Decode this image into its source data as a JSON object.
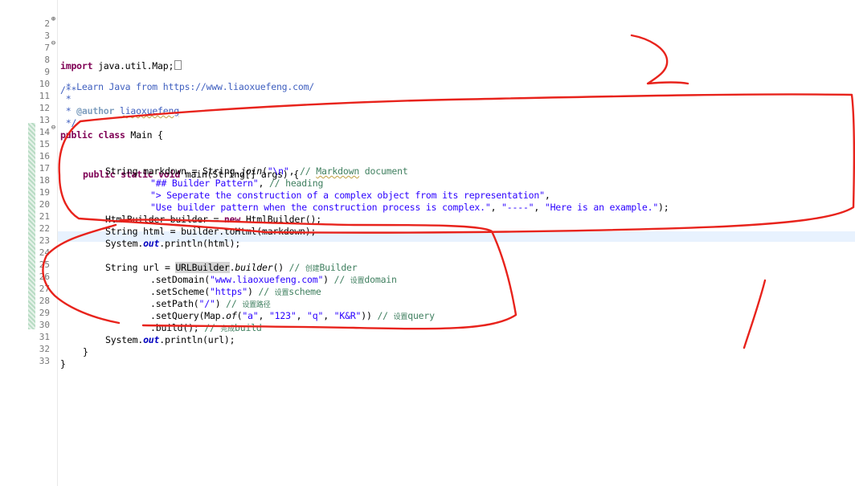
{
  "editor": {
    "lines": [
      {
        "n": "2",
        "fold": ""
      },
      {
        "n": "3",
        "fold": "⊕",
        "import_kw": "import",
        "import_rest": " java.util.Map;"
      },
      {
        "n": "7",
        "fold": ""
      },
      {
        "n": "8",
        "fold": "⊖",
        "text": "/**"
      },
      {
        "n": "9",
        "fold": "",
        "text_a": " * Learn Java from ",
        "text_b": "https://www.liaoxuefeng.com/"
      },
      {
        "n": "10",
        "fold": "",
        "text": " *"
      },
      {
        "n": "11",
        "fold": "",
        "tag": "@author",
        "author": "liaoxuefeng"
      },
      {
        "n": "12",
        "fold": "",
        "text": " */"
      },
      {
        "n": "13",
        "fold": "",
        "kw1": "public",
        "kw2": "class",
        "rest": " Main {"
      },
      {
        "n": "14",
        "fold": ""
      },
      {
        "n": "15",
        "fold": "⊖",
        "kw1": "public",
        "kw2": "static",
        "kw3": "void",
        "rest": " main(String[] args) {"
      },
      {
        "n": "16",
        "fold": "",
        "a": "String markdown = String.",
        "b": "join",
        "c": "(",
        "d": "\"\\n\"",
        "e": ", ",
        "f": "// ",
        "g": "Markdown",
        "h": " document"
      },
      {
        "n": "17",
        "fold": "",
        "s": "\"## Builder Pattern\"",
        "c": ", ",
        "cm": "// heading"
      },
      {
        "n": "18",
        "fold": "",
        "s": "\"> Seperate the construction of a complex object from its representation\"",
        "c": ","
      },
      {
        "n": "19",
        "fold": "",
        "s1": "\"Use builder pattern when the construction process is complex.\"",
        "c1": ", ",
        "s2": "\"----\"",
        "c2": ", ",
        "s3": "\"Here is an example.\"",
        "c3": ");"
      },
      {
        "n": "20",
        "fold": "",
        "a": "HtmlBuilder builder = ",
        "kw": "new",
        "b": " HtmlBuilder();"
      },
      {
        "n": "21",
        "fold": "",
        "text": "String html = builder.toHtml(markdown);"
      },
      {
        "n": "22",
        "fold": "",
        "a": "System.",
        "st": "out",
        "b": ".println(html);"
      },
      {
        "n": "23",
        "fold": ""
      },
      {
        "n": "24",
        "fold": "",
        "a": "String url = ",
        "hl": "URLBuilder",
        "b": ".",
        "it": "builder",
        "c": "() ",
        "cm": "// ",
        "cjk": "创建",
        "cm2": "Builder"
      },
      {
        "n": "25",
        "fold": "",
        "a": ".setDomain(",
        "s": "\"www.liaoxuefeng.com\"",
        "b": ") ",
        "cm": "// ",
        "cjk": "设置",
        "cm2": "domain"
      },
      {
        "n": "26",
        "fold": "",
        "a": ".setScheme(",
        "s": "\"https\"",
        "b": ") ",
        "cm": "// ",
        "cjk": "设置",
        "cm2": "scheme"
      },
      {
        "n": "27",
        "fold": "",
        "a": ".setPath(",
        "s": "\"/\"",
        "b": ") ",
        "cm": "// ",
        "cjk": "设置路径"
      },
      {
        "n": "28",
        "fold": "",
        "a": ".setQuery(Map.",
        "it": "of",
        "b": "(",
        "s1": "\"a\"",
        "c1": ", ",
        "s2": "\"123\"",
        "c2": ", ",
        "s3": "\"q\"",
        "c3": ", ",
        "s4": "\"K&R\"",
        "c4": ")) ",
        "cm": "// ",
        "cjk": "设置",
        "cm2": "query"
      },
      {
        "n": "29",
        "fold": "",
        "a": ".build(); ",
        "cm": "// ",
        "cjk": "完成",
        "cm2": "build"
      },
      {
        "n": "30",
        "fold": "",
        "a": "System.",
        "st": "out",
        "b": ".println(url);"
      },
      {
        "n": "31",
        "fold": "",
        "text": "}"
      },
      {
        "n": "32",
        "fold": "",
        "text": "}"
      },
      {
        "n": "33",
        "fold": ""
      }
    ]
  },
  "annotations": {
    "ink_color": "#e8231c",
    "label_top": "2",
    "label_bottom": "1"
  },
  "colors": {
    "keyword": "#7f0055",
    "comment": "#3f7f5f",
    "javadoc": "#3f5fbf",
    "string": "#2a00ff",
    "static_field": "#0000c0",
    "current_line": "#e8f2fe"
  }
}
